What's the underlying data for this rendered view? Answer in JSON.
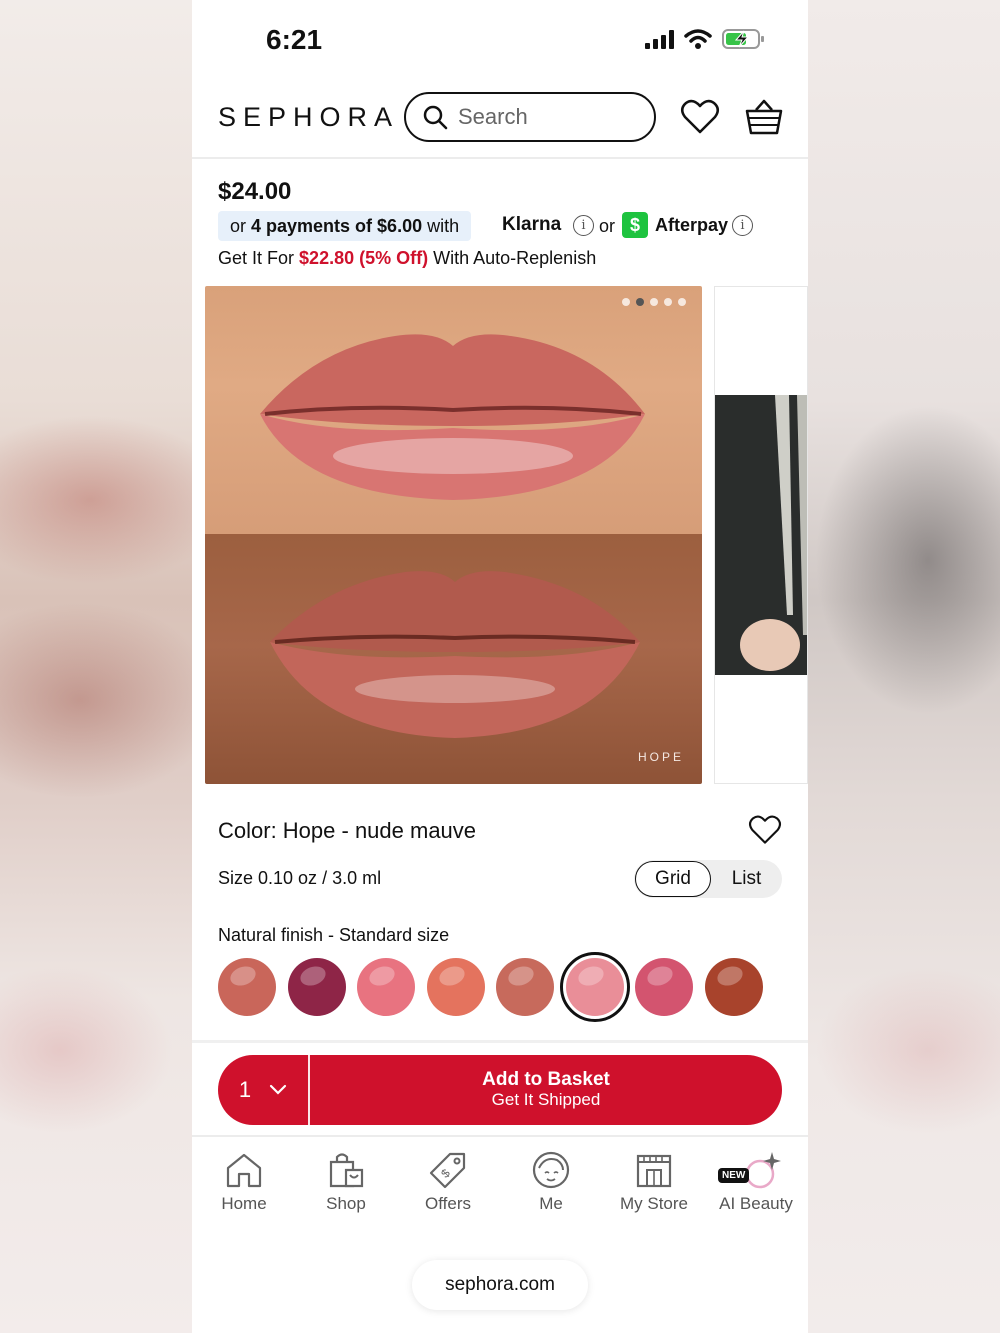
{
  "status_bar": {
    "time": "6:21"
  },
  "header": {
    "logo": "SEPHORA",
    "search_placeholder": "Search"
  },
  "product": {
    "price": "$24.00",
    "installments": {
      "prefix": "or",
      "payments": "4 payments of $6.00",
      "suffix": "with"
    },
    "klarna_label": "Klarna",
    "or_text": "or",
    "afterpay_label": "Afterpay",
    "replenish": {
      "prefix": "Get It For",
      "discount_price": "$22.80 (5% Off)",
      "suffix": "With Auto-Replenish"
    },
    "image_shade_label": "HOPE",
    "carousel": {
      "total": 5,
      "active_index": 1
    },
    "color_label": "Color: Hope - nude mauve",
    "size_label": "Size 0.10 oz / 3.0 ml",
    "view_toggle": {
      "grid": "Grid",
      "list": "List",
      "selected": "Grid"
    },
    "finish_label": "Natural finish - Standard size",
    "swatches": [
      {
        "color": "#c9665a"
      },
      {
        "color": "#8e2547"
      },
      {
        "color": "#e87380"
      },
      {
        "color": "#e4735e"
      },
      {
        "color": "#c76a5c"
      },
      {
        "color": "#e98e98",
        "selected": true
      },
      {
        "color": "#d3546f"
      },
      {
        "color": "#a8432c"
      }
    ]
  },
  "basket": {
    "quantity": "1",
    "title": "Add to Basket",
    "subtitle": "Get It Shipped"
  },
  "nav": {
    "items": [
      {
        "label": "Home",
        "icon": "home-icon"
      },
      {
        "label": "Shop",
        "icon": "shopping-bag-icon"
      },
      {
        "label": "Offers",
        "icon": "tag-icon"
      },
      {
        "label": "Me",
        "icon": "face-icon"
      },
      {
        "label": "My Store",
        "icon": "store-icon"
      },
      {
        "label": "AI Beauty",
        "icon": "sparkle-icon",
        "badge": "NEW"
      }
    ]
  },
  "browser": {
    "url": "sephora.com"
  },
  "colors": {
    "brand_red": "#cf112c",
    "afterpay_green": "#1ec33f"
  }
}
